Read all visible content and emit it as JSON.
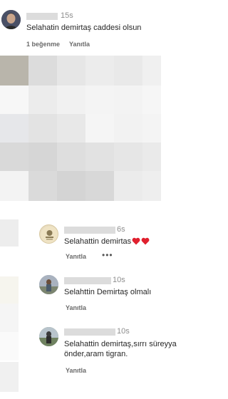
{
  "comments": [
    {
      "time": "15s",
      "text": "Selahatin demirtaş caddesi olsun",
      "likes": "1 beğenme",
      "reply": "Yanıtla"
    }
  ],
  "replies": [
    {
      "time": "6s",
      "text": "Selahattin demirtas",
      "reply": "Yanıtla",
      "more": "•••"
    },
    {
      "time": "10s",
      "text": "Selahttin Demirtaş olmalı",
      "reply": "Yanıtla"
    },
    {
      "time": "10s",
      "text_line1": "Selahattin demirtaş,sırrı süreyya",
      "text_line2": "önder,aram tigran.",
      "reply": "Yanıtla"
    }
  ],
  "colors": {
    "heart": "#e0202e",
    "meta": "#6b6b6b",
    "time": "#8e8e8e"
  }
}
